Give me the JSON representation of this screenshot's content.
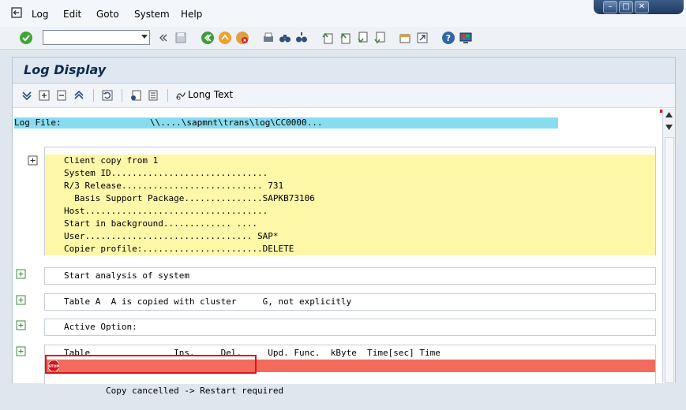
{
  "menubar": {
    "items": [
      "Log",
      "Edit",
      "Goto",
      "System",
      "Help"
    ]
  },
  "window_controls": [
    "minimize-icon",
    "maximize-icon",
    "close-icon"
  ],
  "toolbar": {
    "command_field_value": ""
  },
  "screen": {
    "title": "Log Display",
    "long_text_label": "Long Text"
  },
  "log": {
    "file_label": "Log File:",
    "file_path": "\\\\....\\sapmnt\\trans\\log\\CC0000...",
    "header_rows": [
      "Client copy from 1",
      "System ID.............................. ",
      "R/3 Release........................... 731",
      "  Basis Support Package...............SAPKB73106",
      "Host...................................",
      "Start in background............. ....",
      "User................................ SAP*",
      "Copier profile:.......................DELETE"
    ],
    "analysis_row": "Start analysis of system",
    "table_row": "Table A  A is copied with cluster     G, not explicitly",
    "active_option_row": "Active Option: ",
    "columns_row": "Table                Ins.     Del.     Upd. Func.  kByte  Time[sec] Time",
    "error_row": "Copy cancelled -> Restart required"
  },
  "colors": {
    "highlight_yellow": "#fdf7a8",
    "error_red": "#f26b5d",
    "logfile_cyan": "#88dcf0",
    "annotation_box": "#e01020"
  }
}
